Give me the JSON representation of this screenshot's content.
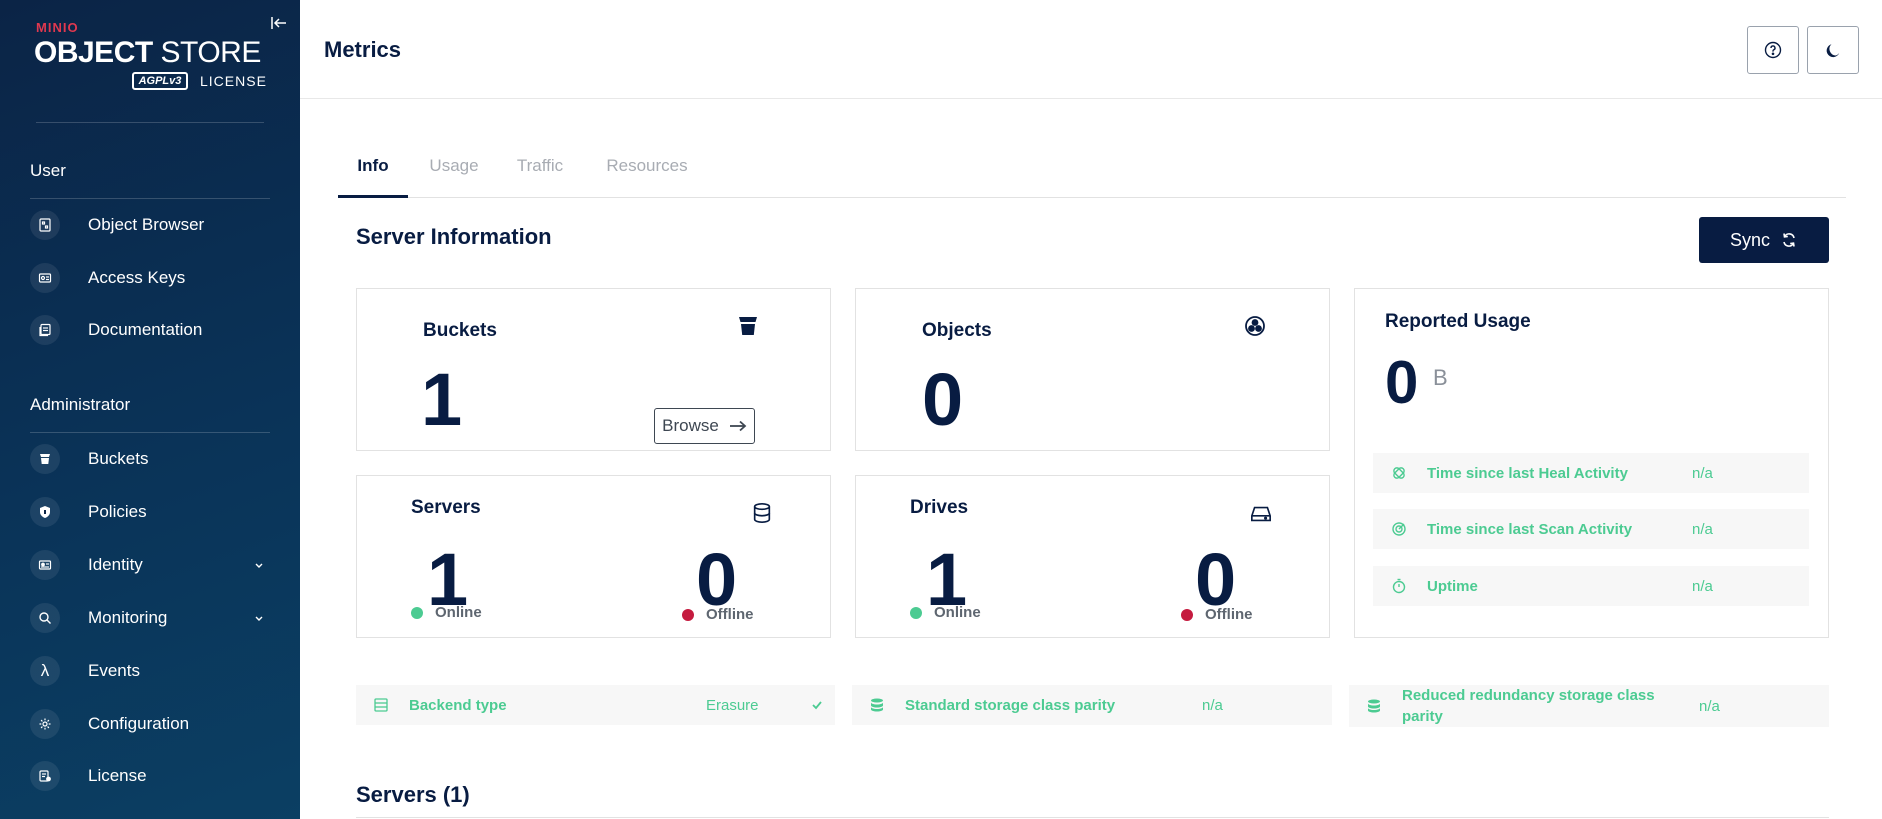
{
  "logo": {
    "brand": "MINIO",
    "product_bold": "OBJECT",
    "product_light": "STORE",
    "badge": "AGPLv3",
    "license": "LICENSE"
  },
  "sidebar": {
    "user_section": "User",
    "user_items": [
      {
        "label": "Object Browser",
        "icon": "object-browser-icon"
      },
      {
        "label": "Access Keys",
        "icon": "access-keys-icon"
      },
      {
        "label": "Documentation",
        "icon": "documentation-icon"
      }
    ],
    "admin_section": "Administrator",
    "admin_items": [
      {
        "label": "Buckets",
        "icon": "bucket-icon"
      },
      {
        "label": "Policies",
        "icon": "policies-icon"
      },
      {
        "label": "Identity",
        "icon": "identity-icon",
        "expandable": true
      },
      {
        "label": "Monitoring",
        "icon": "monitoring-icon",
        "expandable": true
      },
      {
        "label": "Events",
        "icon": "lambda-icon"
      },
      {
        "label": "Configuration",
        "icon": "gear-icon"
      },
      {
        "label": "License",
        "icon": "license-icon"
      }
    ]
  },
  "header": {
    "title": "Metrics"
  },
  "tabs": [
    "Info",
    "Usage",
    "Traffic",
    "Resources"
  ],
  "server_info": {
    "title": "Server Information",
    "sync_label": "Sync",
    "buckets": {
      "title": "Buckets",
      "value": "1",
      "browse": "Browse"
    },
    "objects": {
      "title": "Objects",
      "value": "0"
    },
    "servers": {
      "title": "Servers",
      "online": "1",
      "offline": "0",
      "online_label": "Online",
      "offline_label": "Offline"
    },
    "drives": {
      "title": "Drives",
      "online": "1",
      "offline": "0",
      "online_label": "Online",
      "offline_label": "Offline"
    },
    "usage": {
      "title": "Reported Usage",
      "value": "0",
      "unit": "B",
      "rows": [
        {
          "label": "Time since last Heal Activity",
          "value": "n/a"
        },
        {
          "label": "Time since last Scan Activity",
          "value": "n/a"
        },
        {
          "label": "Uptime",
          "value": "n/a"
        }
      ]
    },
    "bottom": [
      {
        "label": "Backend type",
        "value": "Erasure"
      },
      {
        "label": "Standard storage class parity",
        "value": "n/a"
      },
      {
        "label": "Reduced redundancy storage class parity",
        "value": "n/a"
      }
    ]
  },
  "servers_section": {
    "title": "Servers (1)"
  },
  "colors": {
    "sidebar": "#0b2446",
    "primary": "#081c42",
    "online": "#4ccb92",
    "offline": "#c51b3f",
    "brand_red": "#e0384f"
  }
}
